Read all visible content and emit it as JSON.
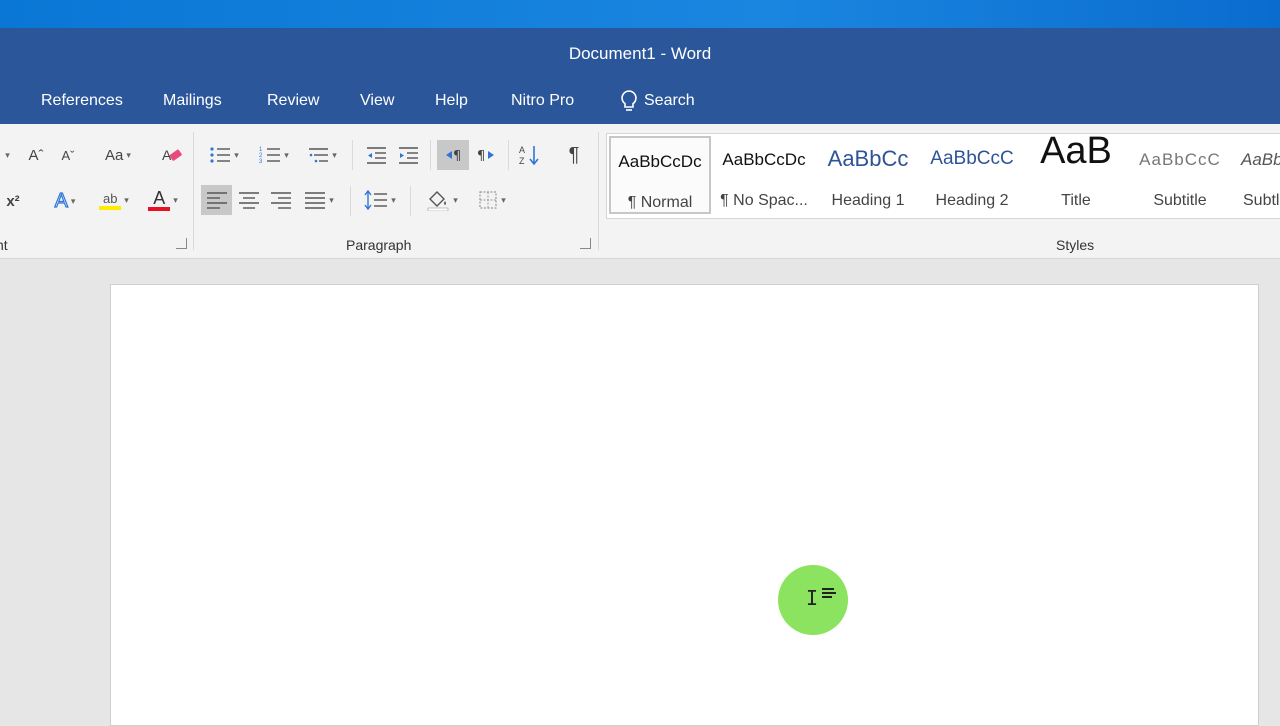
{
  "window": {
    "title": "Document1  -  Word"
  },
  "tabs": [
    "References",
    "Mailings",
    "Review",
    "View",
    "Help",
    "Nitro Pro"
  ],
  "search": {
    "label": "Search"
  },
  "ribbon": {
    "font_group": {
      "grow_label": "Aˆ",
      "shrink_label": "Aˇ",
      "case_label": "Aa",
      "superscript_label": "x²",
      "text_effects_label": "A",
      "highlight_label": "ab",
      "font_color_label": "A",
      "label_fragment": "nt"
    },
    "paragraph_group": {
      "label": "Paragraph",
      "show_marks_label": "¶"
    },
    "styles_group": {
      "label": "Styles",
      "styles": [
        {
          "preview": "AaBbCcDc",
          "label": "¶ Normal"
        },
        {
          "preview": "AaBbCcDc",
          "label": "¶ No Spac..."
        },
        {
          "preview": "AaBbCc",
          "label": "Heading 1"
        },
        {
          "preview": "AaBbCcC",
          "label": "Heading 2"
        },
        {
          "preview": "AaB",
          "label": "Title"
        },
        {
          "preview": "AaBbCcC",
          "label": "Subtitle"
        },
        {
          "preview": "AaBb",
          "label": "Subtl"
        }
      ]
    }
  },
  "colors": {
    "word_blue": "#2b579a",
    "highlight_yellow": "#ffea00",
    "font_red": "#e81123",
    "cursor_green": "#7ee04f"
  }
}
